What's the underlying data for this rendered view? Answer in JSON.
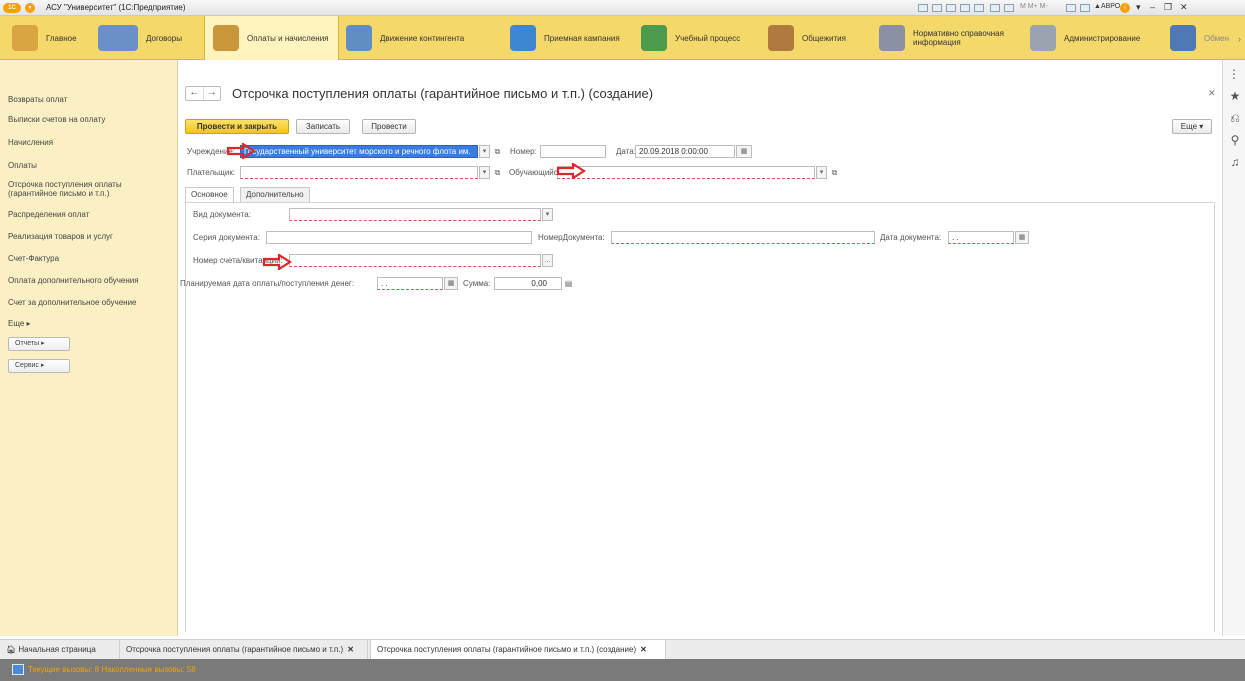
{
  "window": {
    "title": "АСУ \"Университет\" (1С:Предприятие)",
    "logo": "1С",
    "user": "АВРО",
    "memory_buttons": "M  M+  M-"
  },
  "sections": [
    {
      "label": "Главное",
      "icon": "home-desk-icon",
      "color": "#d9a441"
    },
    {
      "label": "Договоры",
      "icon": "handshake-icon",
      "color": "#6b8fc7"
    },
    {
      "label": "Оплаты и начисления",
      "icon": "abacus-icon",
      "color": "#c9973a"
    },
    {
      "label": "Движение контингента",
      "icon": "people-icon",
      "color": "#5f8ec4"
    },
    {
      "label": "Приемная кампания",
      "icon": "chart-up-icon",
      "color": "#3f86d1"
    },
    {
      "label": "Учебный процесс",
      "icon": "blackboard-icon",
      "color": "#4c9a4c"
    },
    {
      "label": "Общежития",
      "icon": "building-icon",
      "color": "#b07a3e"
    },
    {
      "label": "Нормативно справочная информация",
      "icon": "books-icon",
      "color": "#8a8fa3"
    },
    {
      "label": "Администрирование",
      "icon": "tools-icon",
      "color": "#9aa3b0"
    },
    {
      "label": "Обмен",
      "icon": "exchange-icon",
      "color": "#4f79b4"
    }
  ],
  "leftnav": {
    "items": [
      "Возвраты оплат",
      "Выписки счетов на оплату",
      "Начисления",
      "Оплаты",
      "Отсрочка поступления оплаты (гарантийное письмо и т.п.)",
      "Распределения оплат",
      "Реализация товаров и услуг",
      "Счет-Фактура",
      "Оплата дополнительного обучения",
      "Счет за дополнительное обучение"
    ],
    "more": "Еще ▸",
    "reports": "Отчеты ▸",
    "service": "Сервис ▸"
  },
  "form": {
    "title": "Отсрочка поступления оплаты (гарантийное письмо и т.п.) (создание)",
    "buttons": {
      "post_close": "Провести и закрыть",
      "save": "Записать",
      "post": "Провести",
      "more": "Еще ▾"
    },
    "institution_label": "Учреждение:",
    "institution_value": "Государственный университет морского и речного флота им.",
    "number_label": "Номер:",
    "number_value": "",
    "date_label": "Дата:",
    "date_value": "20.09.2018  0:00:00",
    "payer_label": "Плательщик:",
    "student_label": "Обучающийся:",
    "tabs": [
      "Основное",
      "Дополнительно"
    ],
    "doc_type_label": "Вид документа:",
    "doc_series_label": "Серия документа:",
    "doc_number_label": "НомерДокумента:",
    "doc_date_label": "Дата документа:",
    "doc_date_placeholder": "  .  .    ",
    "invoice_label": "Номер счета/квитанции:",
    "planned_date_label": "Планируемая дата оплаты/поступления денег:",
    "planned_date_placeholder": "  .  .    ",
    "sum_label": "Сумма:",
    "sum_value": "0,00"
  },
  "bottom_tabs": [
    "Начальная страница",
    "Отсрочка поступления оплаты (гарантийное письмо и т.п.)",
    "Отсрочка поступления оплаты (гарантийное письмо и т.п.) (создание)"
  ],
  "status": "Текущие вызовы: 8   Накопленные вызовы: 58",
  "annotation_color": "#e0262a"
}
